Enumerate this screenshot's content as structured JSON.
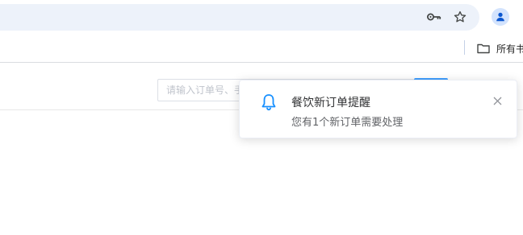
{
  "browser": {
    "icons": {
      "password": "key-icon",
      "bookmark": "star-icon",
      "profile": "person-icon"
    },
    "bookmarks_bar": {
      "folder_label": "所有书",
      "folder_icon": "folder-icon"
    }
  },
  "page": {
    "search": {
      "placeholder": "请输入订单号、手"
    },
    "search_button": {
      "color": "#409eff"
    }
  },
  "notification": {
    "icon": "bell-icon",
    "title": "餐饮新订单提醒",
    "message": "您有1个新订单需要处理",
    "close_icon": "close-icon",
    "accent": "#1890ff"
  },
  "colors": {
    "omnibox_bg": "#edf2fa",
    "profile_bg": "#d3e3fd",
    "profile_fg": "#0b57d0"
  }
}
